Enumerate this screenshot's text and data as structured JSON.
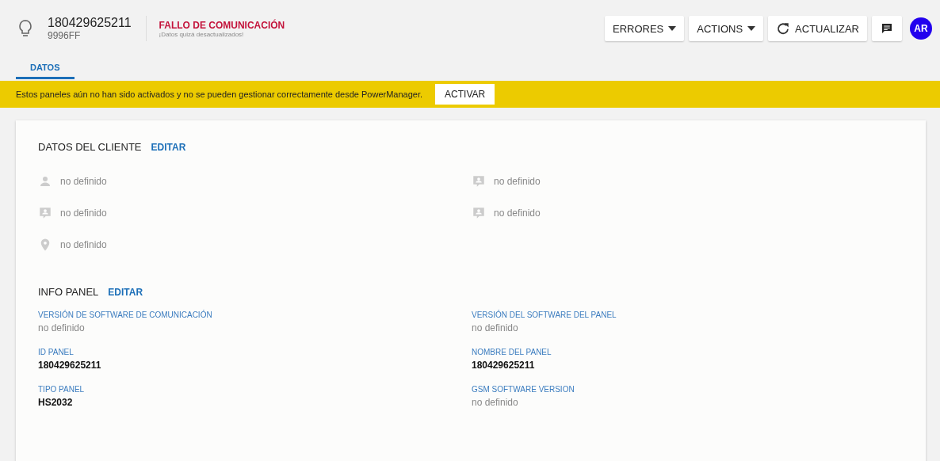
{
  "header": {
    "id": "180429625211",
    "code": "9996FF",
    "status": "FALLO DE COMUNICACIÓN",
    "status_note": "¡Datos quizá desactualizados!",
    "buttons": [
      {
        "label": "ERRORES",
        "kind": "menu"
      },
      {
        "label": "ACTIONS",
        "kind": "menu"
      },
      {
        "label": "ACTUALIZAR",
        "kind": "refresh"
      },
      {
        "kind": "chat"
      }
    ],
    "avatar": "AR"
  },
  "tabs": [
    {
      "label": "DATOS",
      "selected": true
    }
  ],
  "banner": {
    "message": "Estos paneles aún no han sido activados y no se pueden gestionar correctamente desde PowerManager.",
    "button": "ACTIVAR"
  },
  "client": {
    "title": "DATOS DEL CLIENTE",
    "edit": "EDITAR",
    "left": [
      {
        "kind": "person",
        "value": "no definido"
      },
      {
        "kind": "contact",
        "value": "no definido"
      },
      {
        "kind": "location",
        "value": "no definido"
      }
    ],
    "right": [
      {
        "kind": "contact",
        "value": "no definido"
      },
      {
        "kind": "contact",
        "value": "no definido"
      }
    ]
  },
  "info": {
    "title": "INFO PANEL",
    "edit": "EDITAR",
    "fields": [
      {
        "label": "VERSIÓN DE SOFTWARE DE COMUNICACIÓN",
        "value": "no definido",
        "muted": true
      },
      {
        "label": "VERSIÓN DEL SOFTWARE DEL PANEL",
        "value": "no definido",
        "muted": true
      },
      {
        "label": "ID PANEL",
        "value": "180429625211",
        "muted": false
      },
      {
        "label": "NOMBRE DEL PANEL",
        "value": "180429625211",
        "muted": false
      },
      {
        "label": "TIPO PANEL",
        "value": "HS2032",
        "muted": false
      },
      {
        "label": "GSM SOFTWARE VERSION",
        "value": "no definido",
        "muted": true
      }
    ]
  }
}
